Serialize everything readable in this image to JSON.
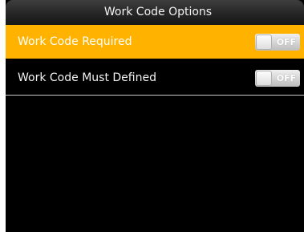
{
  "window": {
    "title": "Work Code Options"
  },
  "options": [
    {
      "label": "Work Code Required",
      "toggle": "OFF",
      "selected": true
    },
    {
      "label": "Work Code Must Defined",
      "toggle": "OFF",
      "selected": false
    }
  ],
  "colors": {
    "highlight": "#ffb300",
    "background": "#000000",
    "toggle_off": "#c4c4c4"
  }
}
